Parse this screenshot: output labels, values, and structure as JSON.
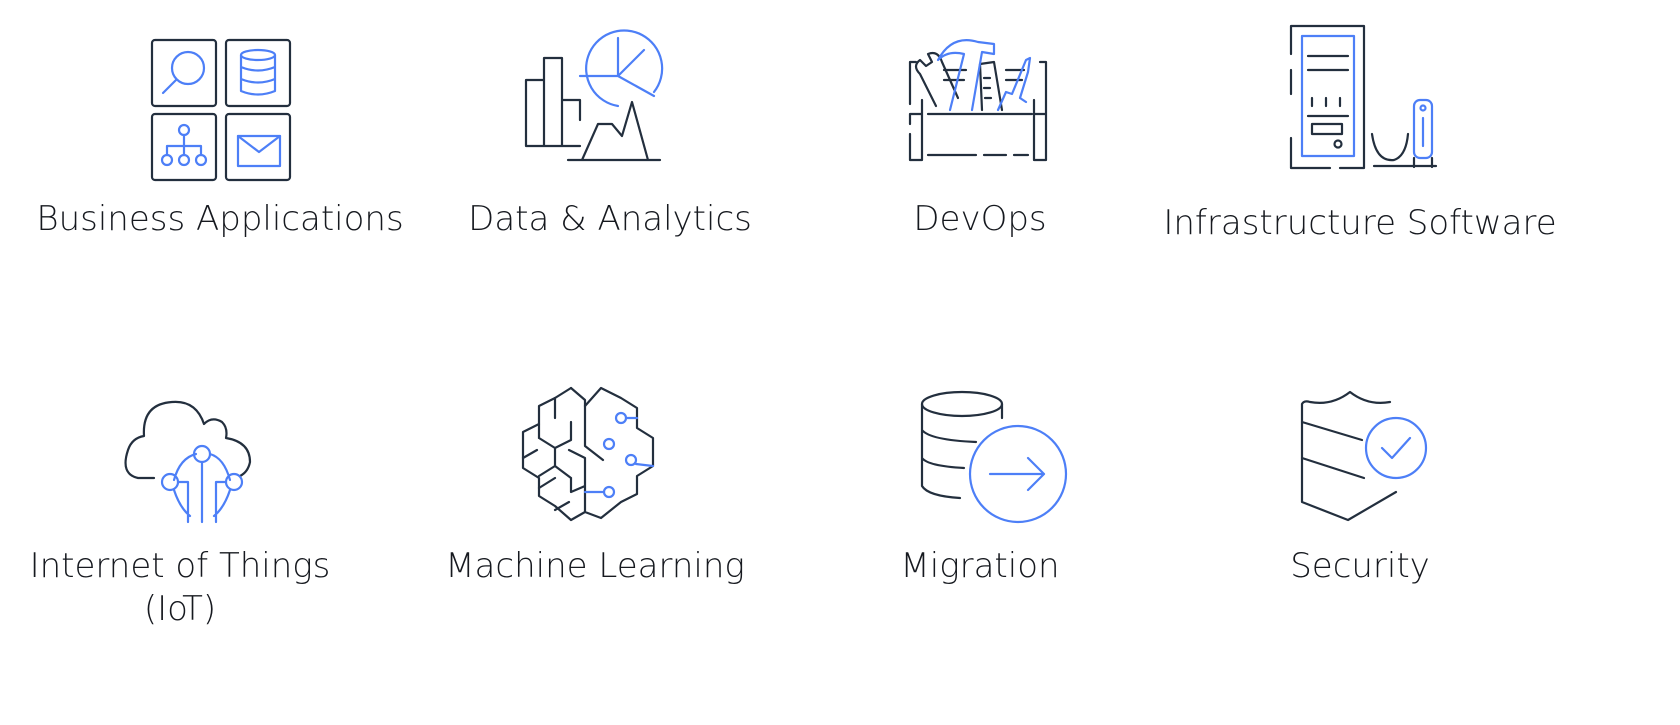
{
  "categories": [
    {
      "id": "business-applications",
      "label": "Business Applications",
      "icon": "business-applications-icon"
    },
    {
      "id": "data-analytics",
      "label": "Data & Analytics",
      "icon": "data-analytics-icon"
    },
    {
      "id": "devops",
      "label": "DevOps",
      "icon": "devops-toolbox-icon"
    },
    {
      "id": "infrastructure-software",
      "label": "Infrastructure Software",
      "icon": "server-tower-icon"
    },
    {
      "id": "iot",
      "label": "Internet of Things",
      "label_line2": "(IoT)",
      "icon": "iot-cloud-icon"
    },
    {
      "id": "machine-learning",
      "label": "Machine Learning",
      "icon": "brain-circuit-icon"
    },
    {
      "id": "migration",
      "label": "Migration",
      "icon": "database-arrow-icon"
    },
    {
      "id": "security",
      "label": "Security",
      "icon": "shield-check-icon"
    }
  ],
  "colors": {
    "outline": "#232f3e",
    "accent": "#4d7ff7",
    "text": "#16191f",
    "background": "#ffffff"
  }
}
